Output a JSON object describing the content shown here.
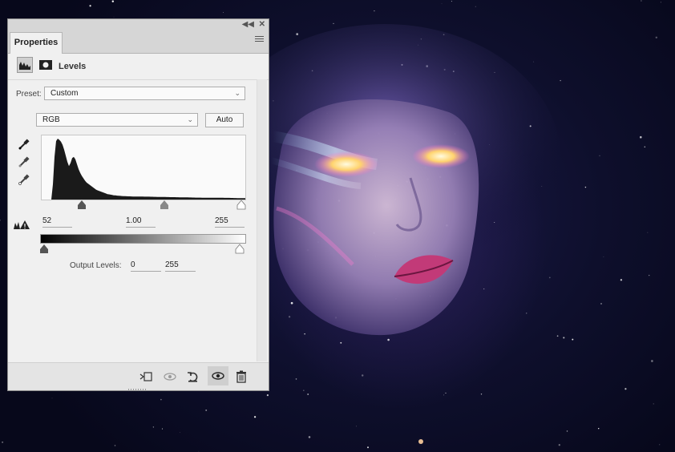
{
  "panel": {
    "tab_label": "Properties",
    "adjustment_title": "Levels",
    "preset_label": "Preset:",
    "preset_value": "Custom",
    "channel_value": "RGB",
    "auto_label": "Auto",
    "input_levels": {
      "black": "52",
      "midtone": "1.00",
      "white": "255"
    },
    "output_levels_label": "Output Levels:",
    "output_levels": {
      "black": "0",
      "white": "255"
    }
  },
  "histogram": {
    "shape": [
      0,
      0,
      0,
      0,
      0,
      0,
      0,
      0.25,
      0.7,
      0.96,
      1,
      0.98,
      0.95,
      0.9,
      0.82,
      0.72,
      0.62,
      0.55,
      0.6,
      0.68,
      0.7,
      0.66,
      0.58,
      0.5,
      0.44,
      0.39,
      0.35,
      0.31,
      0.28,
      0.26,
      0.24,
      0.22,
      0.2,
      0.18,
      0.16,
      0.15,
      0.14,
      0.13,
      0.12,
      0.11,
      0.1,
      0.09,
      0.085,
      0.08,
      0.075,
      0.07,
      0.068,
      0.065,
      0.062,
      0.06,
      0.058,
      0.056,
      0.055,
      0.054,
      0.053,
      0.052,
      0.051,
      0.05,
      0.05,
      0.05,
      0.05,
      0.05,
      0.049,
      0.049,
      0.048,
      0.048,
      0.047,
      0.047,
      0.046,
      0.046,
      0.045,
      0.045,
      0.044,
      0.044,
      0.043,
      0.043,
      0.042,
      0.042,
      0.041,
      0.041,
      0.04,
      0.04,
      0.039,
      0.039,
      0.038,
      0.038,
      0.037,
      0.037,
      0.036,
      0.036,
      0.035,
      0.035,
      0.034,
      0.034,
      0.033,
      0.033,
      0.032,
      0.032,
      0.031,
      0.031,
      0.03,
      0.03,
      0.03,
      0.03,
      0.03,
      0.03,
      0.03,
      0.03,
      0.03,
      0.03,
      0.03,
      0.03,
      0.029,
      0.029,
      0.028,
      0.028,
      0.027,
      0.027,
      0.026,
      0.026,
      0.025,
      0.025,
      0.024,
      0.024,
      0.023,
      0.023,
      0.022,
      0.022
    ]
  },
  "colors": {
    "panel_bg": "#f0f0f0",
    "histogram_fill": "#1a1a1a",
    "space_dark": "#07081b",
    "lip": "#c23a78",
    "eye_glow": "#ffe38a"
  },
  "icons": {
    "collapse": "double-chevron-left-icon",
    "close": "close-icon",
    "menu": "panel-menu-icon",
    "levels": "levels-icon",
    "mask": "mask-icon",
    "eyedroppers": [
      "black-point-eyedropper-icon",
      "gray-point-eyedropper-icon",
      "white-point-eyedropper-icon"
    ],
    "clipping": "clipping-warning-icon",
    "footer": [
      "clip-to-layer-icon",
      "view-previous-state-icon",
      "reset-icon",
      "visibility-icon",
      "delete-icon"
    ]
  }
}
